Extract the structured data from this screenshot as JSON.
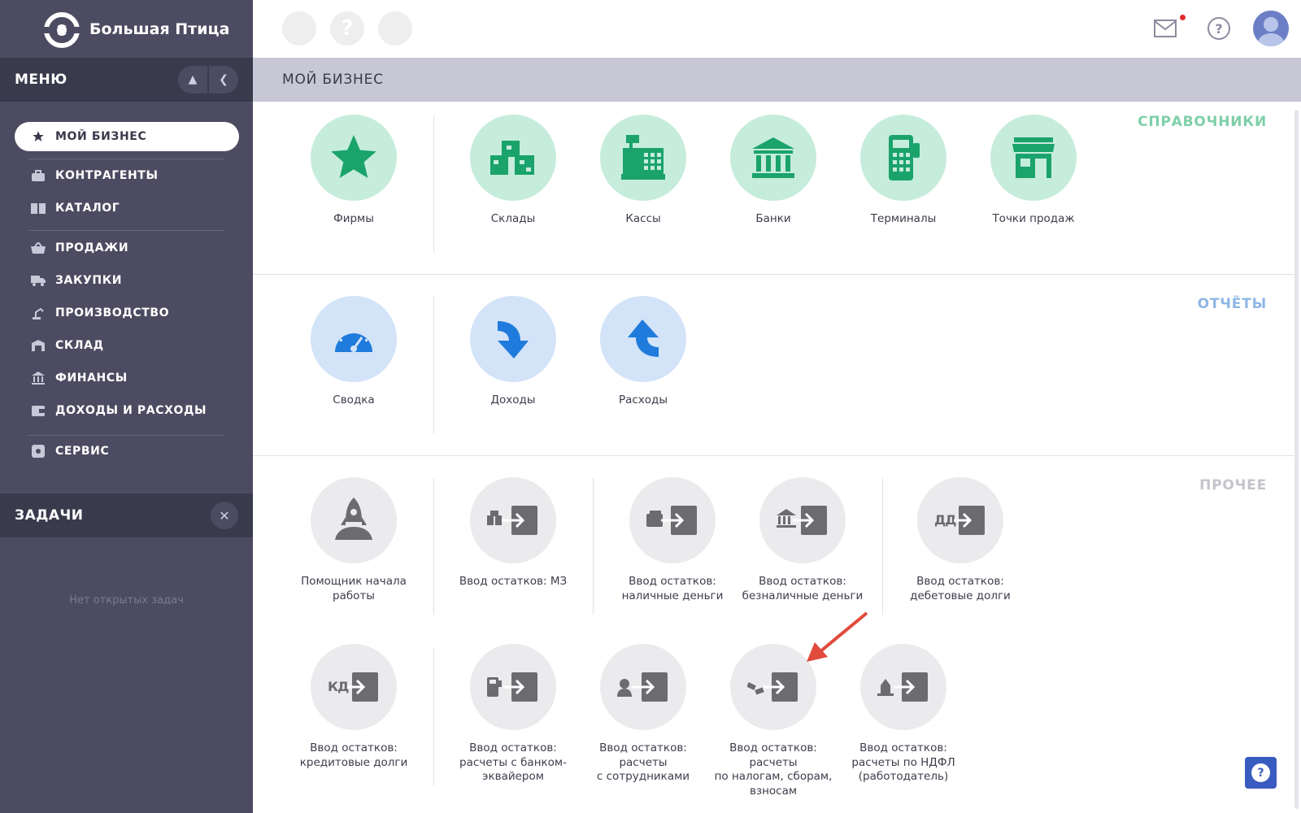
{
  "app": {
    "logo_text": "Большая Птица"
  },
  "sidebar": {
    "menu_title": "МЕНЮ",
    "items": [
      {
        "label": "МОЙ БИЗНЕС",
        "icon": "star-icon",
        "active": true
      },
      {
        "label": "КОНТРАГЕНТЫ",
        "icon": "briefcase-icon"
      },
      {
        "label": "КАТАЛОГ",
        "icon": "book-icon"
      },
      {
        "label": "ПРОДАЖИ",
        "icon": "basket-icon"
      },
      {
        "label": "ЗАКУПКИ",
        "icon": "truck-icon"
      },
      {
        "label": "ПРОИЗВОДСТВО",
        "icon": "robot-arm-icon"
      },
      {
        "label": "СКЛАД",
        "icon": "warehouse-icon"
      },
      {
        "label": "ФИНАНСЫ",
        "icon": "bank-icon"
      },
      {
        "label": "ДОХОДЫ И РАСХОДЫ",
        "icon": "wallet-icon"
      },
      {
        "label": "СЕРВИС",
        "icon": "gear-icon"
      }
    ],
    "tasks_title": "ЗАДАЧИ",
    "no_tasks": "Нет открытых задач"
  },
  "header": {
    "page_title": "МОЙ БИЗНЕС",
    "help_glyph": "?"
  },
  "sections": {
    "directories": {
      "title": "СПРАВОЧНИКИ",
      "color": "#7ecfa9",
      "tiles": [
        "Фирмы",
        "Склады",
        "Кассы",
        "Банки",
        "Терминалы",
        "Точки продаж"
      ]
    },
    "reports": {
      "title": "ОТЧЁТЫ",
      "color": "#8fb7e6",
      "tiles": [
        "Сводка",
        "Доходы",
        "Расходы"
      ]
    },
    "other": {
      "title": "ПРОЧЕЕ",
      "color": "#c4c4cc",
      "tiles": [
        "Помощник начала\nработы",
        "Ввод остатков: МЗ",
        "Ввод остатков:\nналичные деньги",
        "Ввод остатков:\nбезналичные деньги",
        "Ввод остатков:\nдебетовые долги",
        "Ввод остатков:\nкредитовые долги",
        "Ввод остатков:\nрасчеты с банком-\nэквайером",
        "Ввод остатков:\nрасчеты\nс сотрудниками",
        "Ввод остатков:\nрасчеты\nпо налогам, сборам,\nвзносам",
        "Ввод остатков:\nрасчеты по НДФЛ\n(работодатель)"
      ],
      "glyph_dd": "ДД",
      "glyph_kd": "КД"
    }
  },
  "colors": {
    "sidebar": "#4c4b61",
    "green_icon": "#1aa36a",
    "blue_icon": "#1f7bdc",
    "grey_icon": "#6b6b70"
  }
}
